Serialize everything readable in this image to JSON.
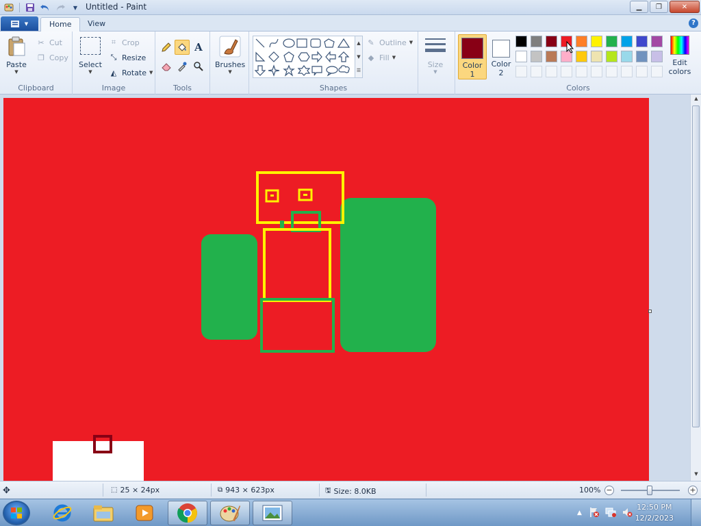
{
  "window": {
    "title": "Untitled - Paint",
    "minimize_icon": "minimize-icon",
    "maximize_icon": "restore-icon",
    "close_icon": "close-icon"
  },
  "quick_access": {
    "save_icon": "save-icon",
    "undo_icon": "undo-icon",
    "redo_icon": "redo-icon",
    "customize_icon": "dropdown-icon"
  },
  "tabs": [
    {
      "label": "Home",
      "active": true
    },
    {
      "label": "View",
      "active": false
    }
  ],
  "help_label": "?",
  "clipboard": {
    "group_label": "Clipboard",
    "paste_label": "Paste",
    "cut_label": "Cut",
    "copy_label": "Copy"
  },
  "image": {
    "group_label": "Image",
    "select_label": "Select",
    "crop_label": "Crop",
    "resize_label": "Resize",
    "rotate_label": "Rotate"
  },
  "tools": {
    "group_label": "Tools",
    "items": [
      "pencil-icon",
      "fill-icon",
      "text-icon",
      "eraser-icon",
      "color-picker-icon",
      "magnifier-icon"
    ],
    "text_glyph": "A",
    "selected": "fill-icon"
  },
  "brushes": {
    "label": "Brushes"
  },
  "shapes": {
    "group_label": "Shapes",
    "outline_label": "Outline",
    "fill_label": "Fill",
    "items": [
      "line",
      "curve",
      "oval",
      "rectangle",
      "rounded-rectangle",
      "polygon",
      "triangle",
      "right-triangle",
      "diamond",
      "pentagon",
      "hexagon",
      "right-arrow",
      "left-arrow",
      "up-arrow",
      "down-arrow",
      "four-point-star",
      "five-point-star",
      "six-point-star",
      "rounded-callout",
      "oval-callout",
      "cloud-callout"
    ]
  },
  "size": {
    "label": "Size"
  },
  "colors": {
    "group_label": "Colors",
    "color1_label": "Color",
    "color1_num": "1",
    "color1_value": "#880015",
    "color2_label": "Color",
    "color2_num": "2",
    "color2_value": "#ffffff",
    "edit_label_1": "Edit",
    "edit_label_2": "colors",
    "palette_row1": [
      "#000000",
      "#7f7f7f",
      "#880015",
      "#ed1c24",
      "#ff7f27",
      "#fff200",
      "#22b14c",
      "#00a2e8",
      "#3f48cc",
      "#a349a4"
    ],
    "palette_row2": [
      "#ffffff",
      "#c3c3c3",
      "#b97a57",
      "#ffaec9",
      "#ffc90e",
      "#efe4b0",
      "#b5e61d",
      "#99d9ea",
      "#7092be",
      "#c8bfe7"
    ],
    "palette_row3_empty": 10
  },
  "canvas": {
    "background": "#ed1c24",
    "accent_yellow": "#fff200",
    "accent_green": "#22b14c",
    "accent_darkred": "#880015"
  },
  "status": {
    "cursor_pos": "",
    "selection_size": "25 × 24px",
    "canvas_size": "943 × 623px",
    "file_size": "Size: 8.0KB",
    "zoom": "100%",
    "zoom_out": "−",
    "zoom_in": "+"
  },
  "taskbar": {
    "apps": [
      "start-orb-icon",
      "internet-explorer-icon",
      "file-explorer-icon",
      "media-player-icon",
      "chrome-icon",
      "paint-icon",
      "photo-viewer-icon"
    ],
    "clock_time": "12:50 PM",
    "clock_date": "12/2/2023"
  }
}
